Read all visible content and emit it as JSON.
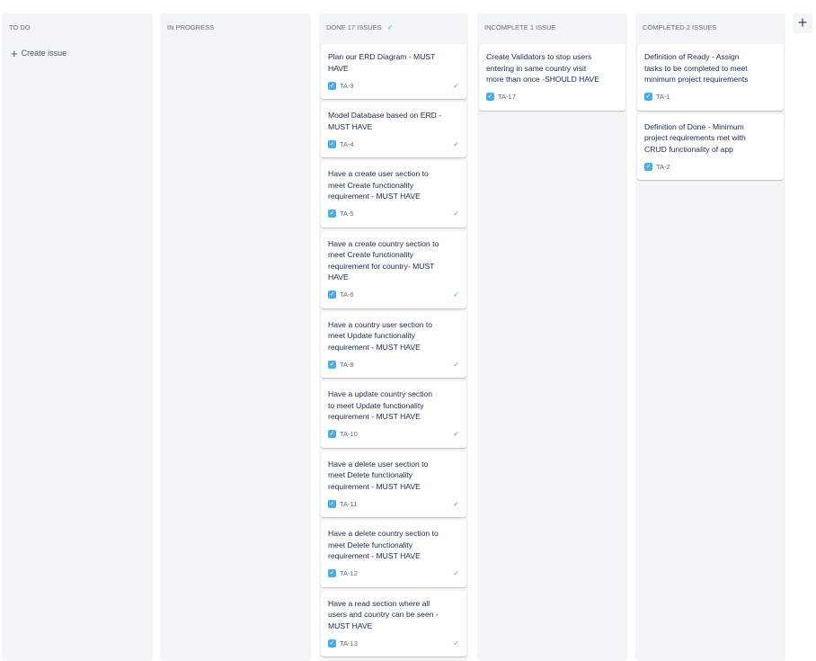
{
  "add_column_label": "+",
  "columns": [
    {
      "title": "TO DO",
      "create_label": "Create issue",
      "cards": []
    },
    {
      "title": "IN PROGRESS",
      "cards": []
    },
    {
      "title": "DONE 17 ISSUES",
      "done": true,
      "cards": [
        {
          "title": "Plan our ERD Diagram - MUST\nHAVE",
          "key": "TA-3",
          "done": true
        },
        {
          "title": "Model Database based on ERD -\nMUST HAVE",
          "key": "TA-4",
          "done": true
        },
        {
          "title": "Have a create user section to\nmeet Create functionality\nrequirement - MUST HAVE",
          "key": "TA-5",
          "done": true
        },
        {
          "title": "Have a create country section to\nmeet Create functionality\nrequirement for country- MUST\nHAVE",
          "key": "TA-6",
          "done": true
        },
        {
          "title": "Have a country user section to\nmeet Update functionality\nrequirement - MUST HAVE",
          "key": "TA-8",
          "done": true
        },
        {
          "title": "Have a update country section\nto meet Update functionality\nrequirement - MUST HAVE",
          "key": "TA-10",
          "done": true
        },
        {
          "title": "Have a delete user section to\nmeet Delete functionality\nrequirement - MUST HAVE",
          "key": "TA-11",
          "done": true
        },
        {
          "title": "Have a delete country section to\nmeet Delete functionality\nrequirement - MUST HAVE",
          "key": "TA-12",
          "done": true
        },
        {
          "title": "Have a read section where all\nusers and country can be seen -\nMUST HAVE",
          "key": "TA-13",
          "done": true
        }
      ]
    },
    {
      "title": "INCOMPLETE 1 ISSUE",
      "cards": [
        {
          "title": "Create Validators to stop users\nentering in same country visit\nmore than once -SHOULD HAVE",
          "key": "TA-17",
          "done": false
        }
      ]
    },
    {
      "title": "COMPLETED 2 ISSUES",
      "cards": [
        {
          "title": "Definition of Ready - Assign\ntasks to be completed to meet\nminimum project requirements",
          "key": "TA-1",
          "done": false
        },
        {
          "title": "Definition of Done - Minimum\nproject requirements met with\nCRUD functionality of app",
          "key": "TA-2",
          "done": false
        }
      ]
    }
  ]
}
